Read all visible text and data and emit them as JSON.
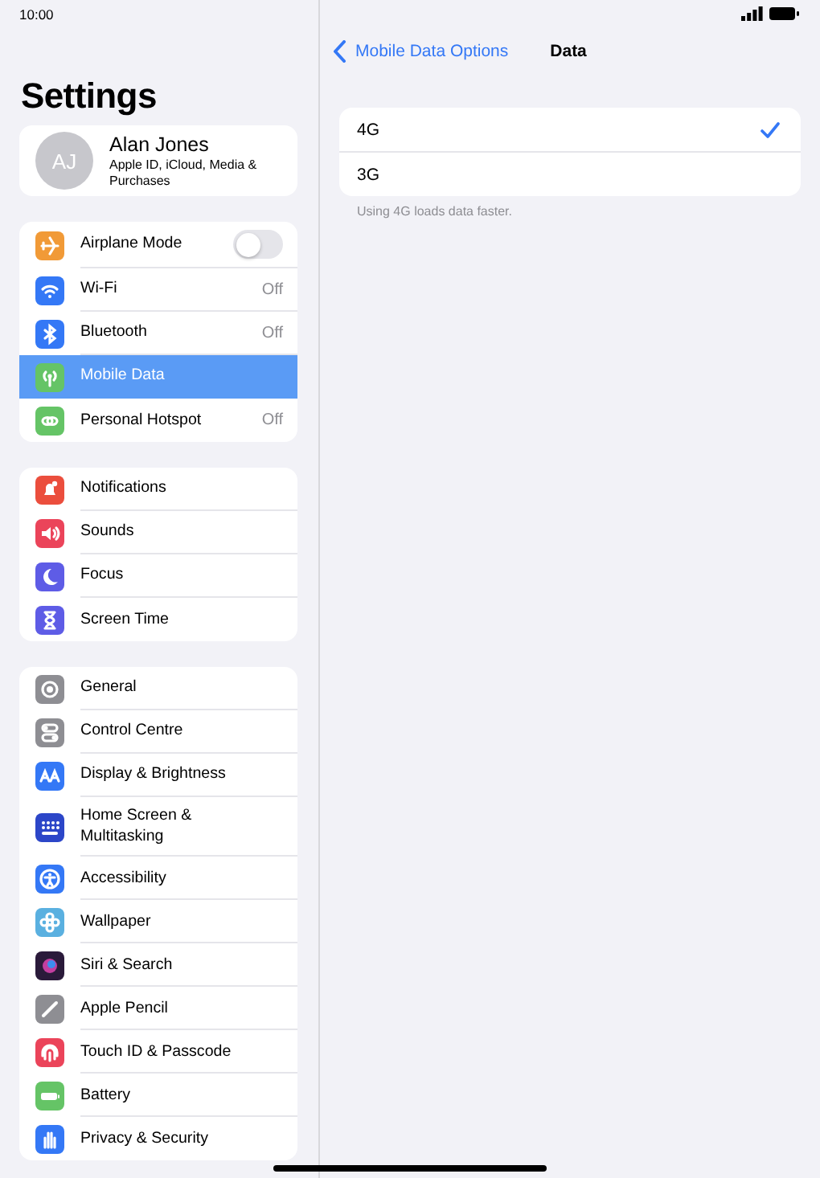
{
  "status_bar": {
    "time": "10:00"
  },
  "sidebar": {
    "title": "Settings",
    "account": {
      "initials": "AJ",
      "name": "Alan Jones",
      "subtitle": "Apple ID, iCloud, Media & Purchases"
    },
    "groups": [
      {
        "items": [
          {
            "label": "Airplane Mode",
            "kind": "toggle",
            "on": false,
            "selected": false
          },
          {
            "label": "Wi-Fi",
            "kind": "value",
            "value": "Off",
            "selected": false
          },
          {
            "label": "Bluetooth",
            "kind": "value",
            "value": "Off",
            "selected": false
          },
          {
            "label": "Mobile Data",
            "kind": "plain",
            "selected": true
          },
          {
            "label": "Personal Hotspot",
            "kind": "value",
            "value": "Off",
            "selected": false
          }
        ]
      },
      {
        "items": [
          {
            "label": "Notifications",
            "kind": "plain",
            "selected": false
          },
          {
            "label": "Sounds",
            "kind": "plain",
            "selected": false
          },
          {
            "label": "Focus",
            "kind": "plain",
            "selected": false
          },
          {
            "label": "Screen Time",
            "kind": "plain",
            "selected": false
          }
        ]
      },
      {
        "items": [
          {
            "label": "General",
            "kind": "plain",
            "selected": false
          },
          {
            "label": "Control Centre",
            "kind": "plain",
            "selected": false
          },
          {
            "label": "Display & Brightness",
            "kind": "plain",
            "selected": false
          },
          {
            "label": "Home Screen & Multitasking",
            "kind": "plain",
            "selected": false
          },
          {
            "label": "Accessibility",
            "kind": "plain",
            "selected": false
          },
          {
            "label": "Wallpaper",
            "kind": "plain",
            "selected": false
          },
          {
            "label": "Siri & Search",
            "kind": "plain",
            "selected": false
          },
          {
            "label": "Apple Pencil",
            "kind": "plain",
            "selected": false
          },
          {
            "label": "Touch ID & Passcode",
            "kind": "plain",
            "selected": false
          },
          {
            "label": "Battery",
            "kind": "plain",
            "selected": false
          },
          {
            "label": "Privacy & Security",
            "kind": "plain",
            "selected": false
          }
        ]
      }
    ]
  },
  "detail": {
    "back": "Mobile Data Options",
    "title": "Data",
    "options": [
      {
        "label": "4G",
        "selected": true
      },
      {
        "label": "3G",
        "selected": false
      }
    ],
    "footer": "Using 4G loads data faster."
  }
}
